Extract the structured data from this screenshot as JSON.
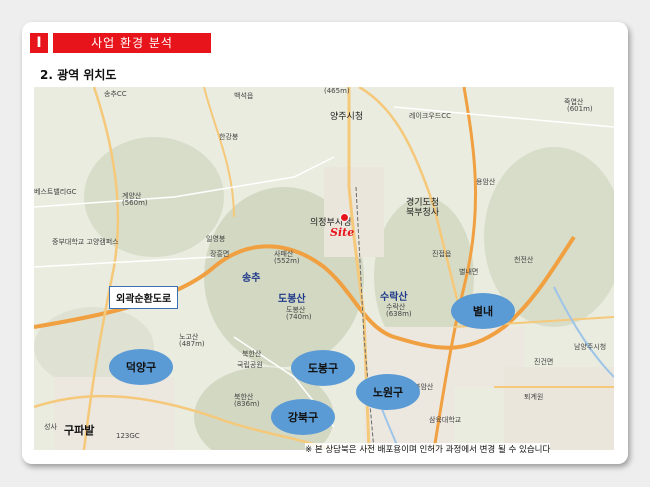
{
  "header": {
    "section_num": "I",
    "section_title": "사업 환경 분석"
  },
  "subtitle": "2. 광역 위치도",
  "map": {
    "site_label": "Site",
    "callout": "외곽순환도로",
    "areas": [
      "덕양구",
      "도봉구",
      "노원구",
      "강북구",
      "별내"
    ],
    "mountains": [
      "송추",
      "도봉산",
      "수락산"
    ],
    "places": {
      "yangju": "양주시청",
      "uijeongbu": "의정부시청",
      "gyeonggi": "경기도청",
      "gyeonggi2": "북부청사",
      "gupabal": "구파발",
      "songchu_cc": "송추CC",
      "best_valley": "베스트밸리GC",
      "yeongrak": "영락교회공원",
      "gyeyangsan": "계양산",
      "jangheung": "장흥면",
      "ilyoungbong": "일영봉",
      "sapaesan": "사패산",
      "dobong_small": "도봉산",
      "surak_small": "수락산",
      "bukhan": "북한산",
      "national_park": "국립공원",
      "noyoung": "노고산",
      "byeolnae_myeon": "별내면",
      "jinjeop": "진접읍",
      "jin_geon": "진건면",
      "toegyewon": "퇴계원",
      "cheonjeon": "천전산",
      "yongamsan": "용암산",
      "jukyeopsan": "죽엽산",
      "namyangju": "남양주시청",
      "joongbu": "중부대학교 고양캠퍼스",
      "kyungdong": "경동대",
      "ramada": "레이크우드CC",
      "baekseok": "백석읍",
      "hanmasan": "한강봉",
      "samyukdae": "삼육대학교",
      "bulam": "불암산",
      "soksa": "성사",
      "sangpyeong": "상평",
      "s123": "123GC"
    },
    "elevations": {
      "gyeyang": "(560m)",
      "sapae": "(552m)",
      "dobong": "(740m)",
      "surak": "(638m)",
      "noyoung": "(487m)",
      "bukhan": "(836m)",
      "jukyeop": "(601m)",
      "top": "(465m)"
    },
    "route_numbers": [
      "360",
      "367",
      "371",
      "39",
      "100",
      "47",
      "43"
    ]
  },
  "note": "※ 본 상담북은 사전  배포용이며 인허가 과정에서 변경 될 수 있습니다",
  "colors": {
    "accent": "#e8141b",
    "ellipse": "#5b9bd5",
    "road": "#f0a040"
  }
}
